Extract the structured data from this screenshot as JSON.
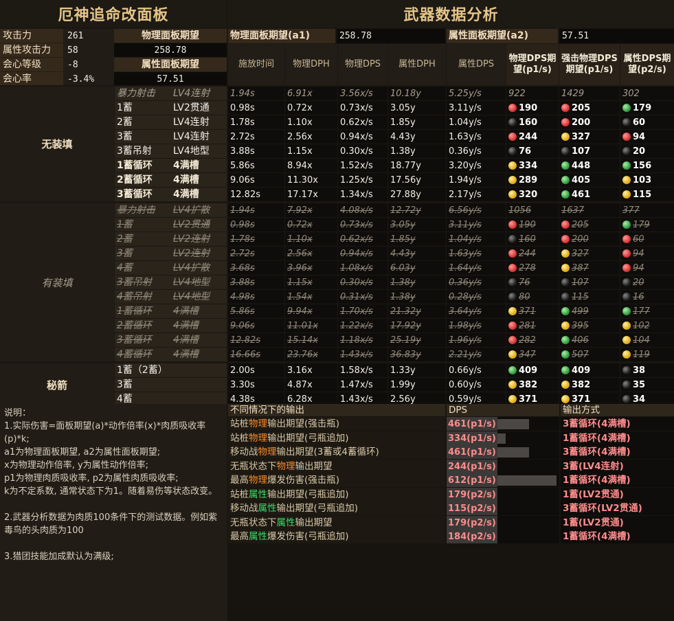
{
  "titles": {
    "left": "厄神追命改面板",
    "right": "武器数据分析"
  },
  "stats": [
    {
      "label": "攻击力",
      "value": "261"
    },
    {
      "label": "属性攻击力",
      "value": "58"
    },
    {
      "label": "会心等级",
      "value": "-8"
    },
    {
      "label": "会心率",
      "value": "-3.4%"
    }
  ],
  "mid_panel": {
    "phys_label": "物理面板期望",
    "phys_value": "258.78",
    "attr_label": "属性面板期望",
    "attr_value": "57.51"
  },
  "top_right": {
    "a1_label": "物理面板期望(a1)",
    "a1_value": "258.78",
    "a2_label": "属性面板期望(a2)",
    "a2_value": "57.51"
  },
  "headers": [
    "施放时间",
    "物理DPH",
    "物理DPS",
    "属性DPH",
    "属性DPS",
    "物理DPS期望(p1/s)",
    "强击物理DPS期望(p1/s)",
    "属性DPS期望(p2/s)"
  ],
  "groups": [
    {
      "label": "无装填",
      "style": "normal",
      "rows": [
        {
          "style": "dim",
          "a": "暴力射击",
          "b": "LV4连射",
          "t": "1.94s",
          "pdph": "6.91x",
          "pdps": "3.56x/s",
          "adph": "10.18y",
          "adps": "5.25y/s",
          "e1": "922",
          "e2": "1429",
          "e3": "302",
          "c1": "",
          "c2": "",
          "c3": ""
        },
        {
          "style": "normal",
          "a": "1蓄",
          "b": "LV2贯通",
          "t": "0.98s",
          "pdph": "0.72x",
          "pdps": "0.73x/s",
          "adph": "3.05y",
          "adps": "3.11y/s",
          "e1": "190",
          "e2": "205",
          "e3": "179",
          "c1": "red",
          "c2": "red",
          "c3": "green"
        },
        {
          "style": "normal",
          "a": "2蓄",
          "b": "LV4连射",
          "t": "1.78s",
          "pdph": "1.10x",
          "pdps": "0.62x/s",
          "adph": "1.85y",
          "adps": "1.04y/s",
          "e1": "160",
          "e2": "200",
          "e3": "60",
          "c1": "black",
          "c2": "red",
          "c3": "black"
        },
        {
          "style": "normal",
          "a": "3蓄",
          "b": "LV4连射",
          "t": "2.72s",
          "pdph": "2.56x",
          "pdps": "0.94x/s",
          "adph": "4.43y",
          "adps": "1.63y/s",
          "e1": "244",
          "e2": "327",
          "e3": "94",
          "c1": "red",
          "c2": "yellow",
          "c3": "red"
        },
        {
          "style": "normal",
          "a": "3蓄吊射",
          "b": "LV4地型",
          "t": "3.88s",
          "pdph": "1.15x",
          "pdps": "0.30x/s",
          "adph": "1.38y",
          "adps": "0.36y/s",
          "e1": "76",
          "e2": "107",
          "e3": "20",
          "c1": "black",
          "c2": "black",
          "c3": "black"
        },
        {
          "style": "strong",
          "a": "1蓄循环",
          "b": "4满槽",
          "t": "5.86s",
          "pdph": "8.94x",
          "pdps": "1.52x/s",
          "adph": "18.77y",
          "adps": "3.20y/s",
          "e1": "334",
          "e2": "448",
          "e3": "156",
          "c1": "yellow",
          "c2": "green",
          "c3": "green"
        },
        {
          "style": "strong",
          "a": "2蓄循环",
          "b": "4满槽",
          "t": "9.06s",
          "pdph": "11.30x",
          "pdps": "1.25x/s",
          "adph": "17.56y",
          "adps": "1.94y/s",
          "e1": "289",
          "e2": "405",
          "e3": "103",
          "c1": "yellow",
          "c2": "green",
          "c3": "yellow"
        },
        {
          "style": "strong",
          "a": "3蓄循环",
          "b": "4满槽",
          "t": "12.82s",
          "pdph": "17.17x",
          "pdps": "1.34x/s",
          "adph": "27.88y",
          "adps": "2.17y/s",
          "e1": "320",
          "e2": "461",
          "e3": "115",
          "c1": "yellow",
          "c2": "green",
          "c3": "yellow"
        }
      ]
    },
    {
      "label": "有装填",
      "style": "dim",
      "rows": [
        {
          "style": "strike",
          "a": "暴力射击",
          "b": "LV4扩散",
          "t": "1.94s",
          "pdph": "7.92x",
          "pdps": "4.08x/s",
          "adph": "12.72y",
          "adps": "6.56y/s",
          "e1": "1056",
          "e2": "1637",
          "e3": "377",
          "c1": "",
          "c2": "",
          "c3": ""
        },
        {
          "style": "strike",
          "a": "1蓄",
          "b": "LV2贯通",
          "t": "0.98s",
          "pdph": "0.72x",
          "pdps": "0.73x/s",
          "adph": "3.05y",
          "adps": "3.11y/s",
          "e1": "190",
          "e2": "205",
          "e3": "179",
          "c1": "red",
          "c2": "red",
          "c3": "green"
        },
        {
          "style": "strike",
          "a": "2蓄",
          "b": "LV2连射",
          "t": "1.78s",
          "pdph": "1.10x",
          "pdps": "0.62x/s",
          "adph": "1.85y",
          "adps": "1.04y/s",
          "e1": "160",
          "e2": "200",
          "e3": "60",
          "c1": "black",
          "c2": "red",
          "c3": "red"
        },
        {
          "style": "strike",
          "a": "3蓄",
          "b": "LV2连射",
          "t": "2.72s",
          "pdph": "2.56x",
          "pdps": "0.94x/s",
          "adph": "4.43y",
          "adps": "1.63y/s",
          "e1": "244",
          "e2": "327",
          "e3": "94",
          "c1": "red",
          "c2": "yellow",
          "c3": "red"
        },
        {
          "style": "strike",
          "a": "4蓄",
          "b": "LV4扩散",
          "t": "3.68s",
          "pdph": "3.96x",
          "pdps": "1.08x/s",
          "adph": "6.03y",
          "adps": "1.64y/s",
          "e1": "278",
          "e2": "387",
          "e3": "94",
          "c1": "red",
          "c2": "yellow",
          "c3": "red"
        },
        {
          "style": "strike",
          "a": "3蓄吊射",
          "b": "LV4地型",
          "t": "3.88s",
          "pdph": "1.15x",
          "pdps": "0.30x/s",
          "adph": "1.38y",
          "adps": "0.36y/s",
          "e1": "76",
          "e2": "107",
          "e3": "20",
          "c1": "black",
          "c2": "black",
          "c3": "black"
        },
        {
          "style": "strike",
          "a": "4蓄吊射",
          "b": "LV4地型",
          "t": "4.98s",
          "pdph": "1.54x",
          "pdps": "0.31x/s",
          "adph": "1.38y",
          "adps": "0.28y/s",
          "e1": "80",
          "e2": "115",
          "e3": "16",
          "c1": "black",
          "c2": "black",
          "c3": "black"
        },
        {
          "style": "strike",
          "a": "1蓄循环",
          "b": "4满槽",
          "t": "5.86s",
          "pdph": "9.94x",
          "pdps": "1.70x/s",
          "adph": "21.32y",
          "adps": "3.64y/s",
          "e1": "371",
          "e2": "499",
          "e3": "177",
          "c1": "yellow",
          "c2": "green",
          "c3": "green"
        },
        {
          "style": "strike",
          "a": "2蓄循环",
          "b": "4满槽",
          "t": "9.06s",
          "pdph": "11.01x",
          "pdps": "1.22x/s",
          "adph": "17.92y",
          "adps": "1.98y/s",
          "e1": "281",
          "e2": "395",
          "e3": "102",
          "c1": "red",
          "c2": "yellow",
          "c3": "yellow"
        },
        {
          "style": "strike",
          "a": "3蓄循环",
          "b": "4满槽",
          "t": "12.82s",
          "pdph": "15.14x",
          "pdps": "1.18x/s",
          "adph": "25.19y",
          "adps": "1.96y/s",
          "e1": "282",
          "e2": "406",
          "e3": "104",
          "c1": "red",
          "c2": "green",
          "c3": "yellow"
        },
        {
          "style": "strike",
          "a": "4蓄循环",
          "b": "4满槽",
          "t": "16.66s",
          "pdph": "23.76x",
          "pdps": "1.43x/s",
          "adph": "36.83y",
          "adps": "2.21y/s",
          "e1": "347",
          "e2": "507",
          "e3": "119",
          "c1": "yellow",
          "c2": "green",
          "c3": "yellow"
        }
      ]
    },
    {
      "label": "秘箭",
      "style": "normal",
      "rows": [
        {
          "style": "normal",
          "a": "1蓄（2蓄）",
          "b": "",
          "t": "2.00s",
          "pdph": "3.16x",
          "pdps": "1.58x/s",
          "adph": "1.33y",
          "adps": "0.66y/s",
          "e1": "409",
          "e2": "409",
          "e3": "38",
          "c1": "green",
          "c2": "green",
          "c3": "black"
        },
        {
          "style": "normal",
          "a": "3蓄",
          "b": "",
          "t": "3.30s",
          "pdph": "4.87x",
          "pdps": "1.47x/s",
          "adph": "1.99y",
          "adps": "0.60y/s",
          "e1": "382",
          "e2": "382",
          "e3": "35",
          "c1": "yellow",
          "c2": "yellow",
          "c3": "black"
        },
        {
          "style": "normal",
          "a": "4蓄",
          "b": "",
          "t": "4.38s",
          "pdph": "6.28x",
          "pdps": "1.43x/s",
          "adph": "2.56y",
          "adps": "0.59y/s",
          "e1": "371",
          "e2": "371",
          "e3": "34",
          "c1": "yellow",
          "c2": "yellow",
          "c3": "black"
        }
      ]
    }
  ],
  "notes": "说明：\n1.实际伤害=面板期望(a)*动作倍率(x)*肉质吸收率(p)*k;\na1为物理面板期望, a2为属性面板期望;\nx为物理动作倍率, y为属性动作倍率;\np1为物理肉质吸收率, p2为属性肉质吸收率;\nk为不定系数, 通常状态下为1。随着易伤等状态改变。\n\n2.武器分析数据为肉质100条件下的测试数据。例如紫毒鸟的头肉质为100\n\n3.猎团技能加成默认为满级;",
  "summary": {
    "headers": [
      "不同情况下的输出",
      "DPS",
      "输出方式"
    ],
    "rows": [
      {
        "pre": "站桩",
        "hl": "物理",
        "hlc": "orange",
        "post": "输出期望(强击瓶)",
        "dps": "461(p1/s)",
        "frac": 0.75,
        "method": "3蓄循环(4满槽)"
      },
      {
        "pre": "站桩",
        "hl": "物理",
        "hlc": "orange",
        "post": "输出期望(弓瓶追加)",
        "dps": "334(p1/s)",
        "frac": 0.54,
        "method": "1蓄循环(4满槽)"
      },
      {
        "pre": "移动战",
        "hl": "物理",
        "hlc": "orange",
        "post": "输出期望(3蓄或4蓄循环)",
        "dps": "461(p1/s)",
        "frac": 0.75,
        "method": "3蓄循环(4满槽)"
      },
      {
        "pre": "无瓶状态下",
        "hl": "物理",
        "hlc": "orange",
        "post": "输出期望",
        "dps": "244(p1/s)",
        "frac": 0.4,
        "method": "3蓄(LV4连射)"
      },
      {
        "pre": "最高",
        "hl": "物理",
        "hlc": "orange",
        "post": "爆发伤害(强击瓶)",
        "dps": "612(p1/s)",
        "frac": 1.0,
        "method": "1蓄循环(4满槽)"
      },
      {
        "pre": "站桩",
        "hl": "属性",
        "hlc": "green",
        "post": "输出期望(弓瓶追加)",
        "dps": "179(p2/s)",
        "frac": 0.29,
        "method": "1蓄(LV2贯通)"
      },
      {
        "pre": "移动战",
        "hl": "属性",
        "hlc": "green",
        "post": "输出期望(弓瓶追加)",
        "dps": "115(p2/s)",
        "frac": 0.19,
        "method": "3蓄循环(LV2贯通)"
      },
      {
        "pre": "无瓶状态下",
        "hl": "属性",
        "hlc": "green",
        "post": "输出期望",
        "dps": "179(p2/s)",
        "frac": 0.29,
        "method": "1蓄(LV2贯通)"
      },
      {
        "pre": "最高",
        "hl": "属性",
        "hlc": "green",
        "post": "爆发伤害(弓瓶追加)",
        "dps": "184(p2/s)",
        "frac": 0.3,
        "method": "1蓄循环(4满槽)"
      }
    ]
  }
}
